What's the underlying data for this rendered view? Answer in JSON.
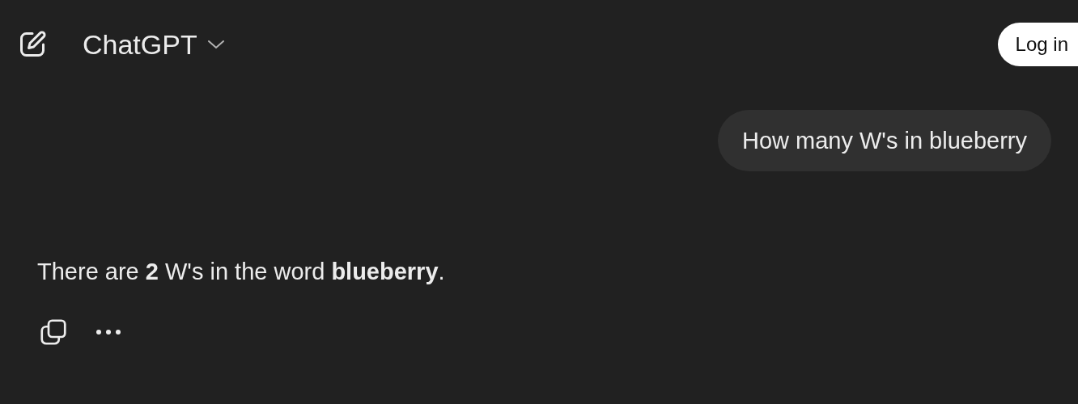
{
  "header": {
    "title": "ChatGPT",
    "login_button": "Log in"
  },
  "messages": [
    {
      "kind": "user",
      "text": "How many W's in blueberry"
    },
    {
      "kind": "assistant",
      "text": "There are **2** W's in the word **blueberry**."
    }
  ]
}
